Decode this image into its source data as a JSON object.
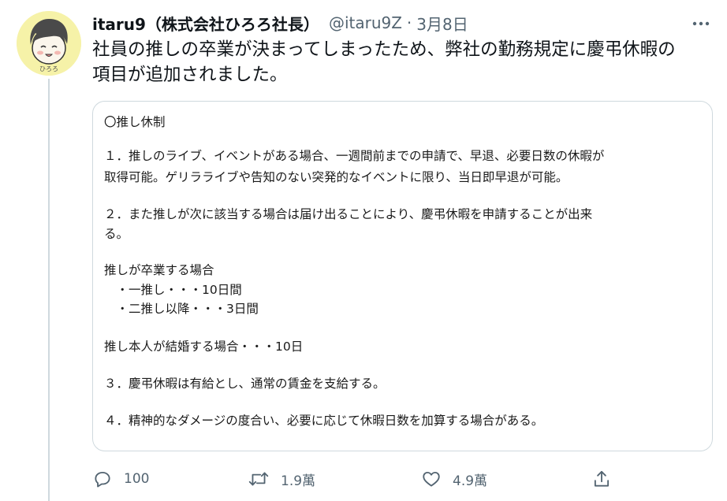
{
  "tweet": {
    "display_name": "itaru9（株式会社ひろろ社長）",
    "handle": "@itaru9Z",
    "separator": "·",
    "date": "3月8日",
    "text_lines": [
      "社員の推しの卒業が決まってしまったため、弊社の勤務規定に慶弔休暇の",
      "項目が追加されました。"
    ]
  },
  "avatar": {
    "label": "ひろろ",
    "background_color": "#f6f2a8"
  },
  "document": {
    "lines": [
      "〇推し休制",
      "１．推しのライブ、イベントがある場合、一週間前までの申請で、早退、必要日数の休暇が",
      "取得可能。ゲリラライブや告知のない突発的なイベントに限り、当日即早退が可能。",
      "２．また推しが次に該当する場合は届け出ることにより、慶弔休暇を申請することが出来",
      "る。",
      "推しが卒業する場合",
      "　・一推し・・・10日間",
      "　・二推し以降・・・3日間",
      "推し本人が結婚する場合・・・10日",
      "３．慶弔休暇は有給とし、通常の賃金を支給する。",
      "４．精神的なダメージの度合い、必要に応じて休暇日数を加算する場合がある。"
    ]
  },
  "actions": {
    "reply_count": "100",
    "retweet_count": "1.9萬",
    "like_count": "4.9萬"
  },
  "colors": {
    "text": "#0f1419",
    "secondary": "#536471",
    "border": "#cfd9de"
  }
}
